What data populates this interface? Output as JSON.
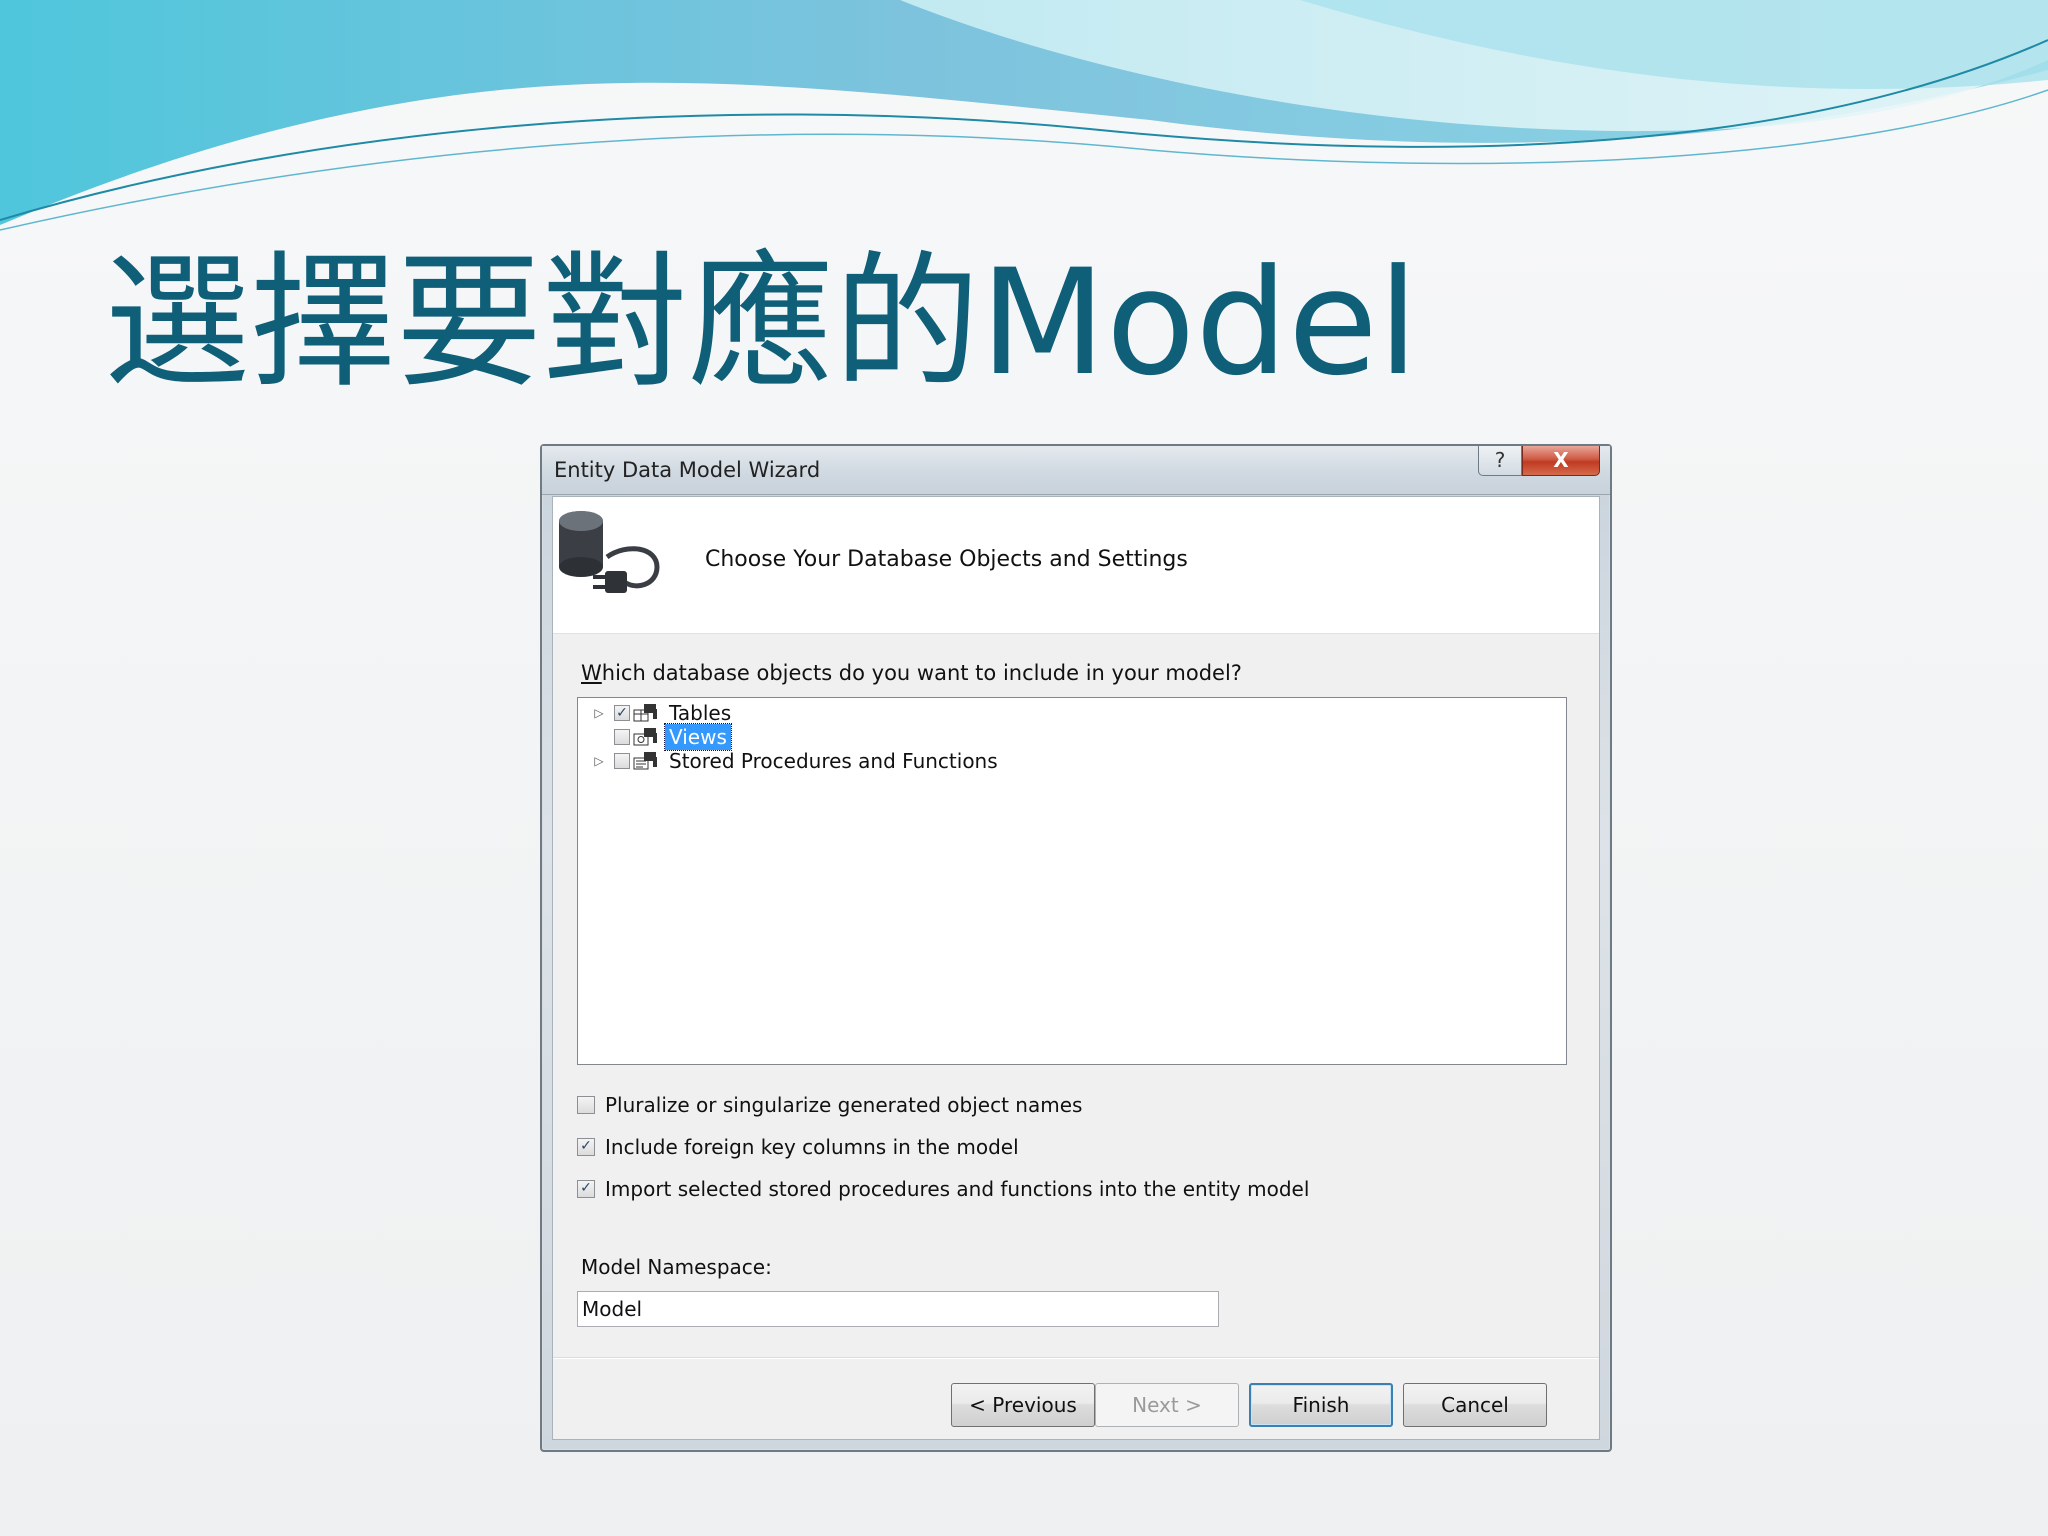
{
  "slide": {
    "title": "選擇要對應的Model"
  },
  "dialog": {
    "title": "Entity Data Model Wizard",
    "help_glyph": "?",
    "close_glyph": "X",
    "header_title": "Choose Your Database Objects and Settings",
    "question": "Which database objects do you want to include in your model?",
    "tree": [
      {
        "label": "Tables",
        "checked": true,
        "expandable": true,
        "selected": false
      },
      {
        "label": "Views",
        "checked": false,
        "expandable": false,
        "selected": true
      },
      {
        "label": "Stored Procedures and Functions",
        "checked": false,
        "expandable": true,
        "selected": false
      }
    ],
    "options": {
      "pluralize": {
        "label": "Pluralize or singularize generated object names",
        "checked": false
      },
      "foreign_keys": {
        "label": "Include foreign key columns in the model",
        "checked": true
      },
      "import_procs": {
        "label": "Import selected stored procedures and functions into the entity model",
        "checked": true
      }
    },
    "namespace": {
      "label": "Model Namespace:",
      "value": "Model"
    },
    "buttons": {
      "previous": "< Previous",
      "next": "Next >",
      "finish": "Finish",
      "cancel": "Cancel"
    },
    "check_glyph": "✓"
  },
  "colors": {
    "title": "#0f5f78",
    "selection": "#3399ff",
    "close_button": "#c03a22"
  }
}
